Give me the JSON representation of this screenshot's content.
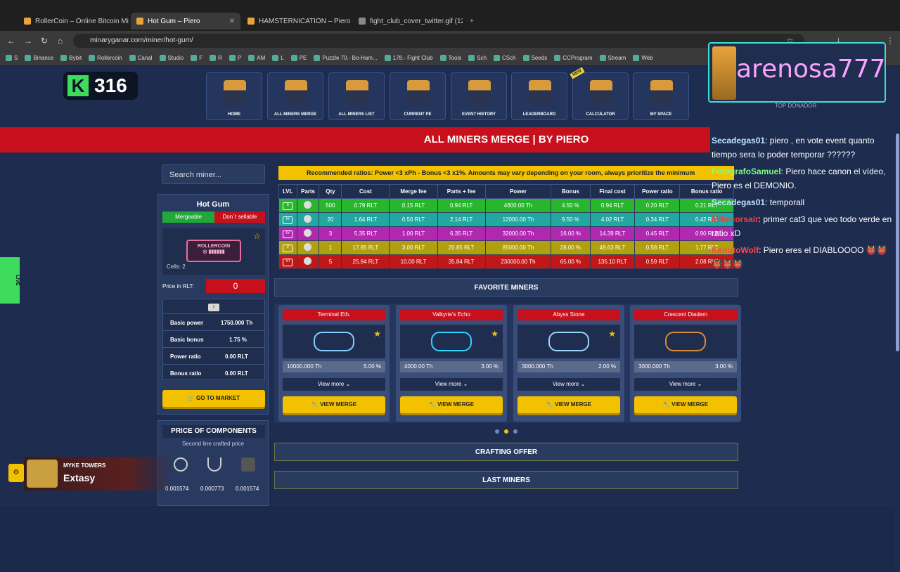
{
  "browser": {
    "tabs": [
      {
        "title": "RollerCoin – Online Bitcoin Mi",
        "active": false
      },
      {
        "title": "Hot Gum – Piero",
        "active": true
      },
      {
        "title": "HAMSTERNICATION – Piero",
        "active": false
      },
      {
        "title": "fight_club_cover_twitter.gif (12",
        "active": false
      }
    ],
    "url": "minaryganar.com/miner/hot-gum/",
    "bookmarks": [
      "S",
      "Binance",
      "Bybit",
      "Rollercoin",
      "Canal",
      "Studio",
      "F",
      "R",
      "P",
      "AM",
      "L",
      "PE",
      "Puzzle 70.- Bo-Ham...",
      "178.- Fight Club",
      "Tools",
      "Sch",
      "CSch",
      "Seeds",
      "CCProgram",
      "Stream",
      "Web"
    ]
  },
  "site": {
    "logo_count": "316",
    "nav": [
      {
        "label": "HOME"
      },
      {
        "label": "ALL MINERS MERGE"
      },
      {
        "label": "ALL MINERS LIST"
      },
      {
        "label": "CURRENT PE"
      },
      {
        "label": "EVENT HISTORY"
      },
      {
        "label": "LEADERBOARD"
      },
      {
        "label": "CALCULATOR",
        "badge": "NEW"
      },
      {
        "label": "MY SPACE"
      }
    ],
    "banner_title": "ALL MINERS MERGE | BY PIERO"
  },
  "left": {
    "search_placeholder": "Search miner...",
    "miner_name": "Hot Gum",
    "mergeable": "Mergeable",
    "not_sellable": "Don´t sellable",
    "miner_image_text": "ROLLERCOIN",
    "cells": "Cells: 2",
    "price_label": "Price in RLT:",
    "price_value": "0",
    "level_badge": "I",
    "stats": [
      {
        "label": "Basic power",
        "value": "1750.000 Th"
      },
      {
        "label": "Basic bonus",
        "value": "1.75 %"
      },
      {
        "label": "Power ratio",
        "value": "0.00 RLT"
      },
      {
        "label": "Bonus ratio",
        "value": "0.00 RLT"
      }
    ],
    "go_market": "GO TO MARKET",
    "price_components_title": "PRICE OF COMPONENTS",
    "price_components_sub": "Second line crafted price",
    "components": [
      "0.001574",
      "0.000773",
      "0.001574"
    ]
  },
  "ratios": {
    "recommendation": "Recommended ratios: Power <3 xPh - Bonus <3 x1%. Amounts may vary depending on your room, always prioritize the minimum",
    "headers": [
      "LVL",
      "Parts",
      "Qty",
      "Cost",
      "Merge fee",
      "Parts + fee",
      "Power",
      "Bonus",
      "Final cost",
      "Power ratio",
      "Bonus ratio"
    ],
    "rows": [
      {
        "lvl": "II",
        "color": "#2ab52e",
        "qty": "500",
        "cost": "0.79 RLT",
        "fee": "0.15 RLT",
        "parts_fee": "0.94 RLT",
        "power": "4600.00 Th",
        "bonus": "4.50 %",
        "final": "0.94 RLT",
        "pratio": "0.20 RLT",
        "bratio": "0.21 RLT"
      },
      {
        "lvl": "III",
        "color": "#22a8a0",
        "qty": "20",
        "cost": "1.64 RLT",
        "fee": "0.50 RLT",
        "parts_fee": "2.14 RLT",
        "power": "12000.00 Th",
        "bonus": "9.50 %",
        "final": "4.02 RLT",
        "pratio": "0.34 RLT",
        "bratio": "0.42 RLT"
      },
      {
        "lvl": "IV",
        "color": "#b028b0",
        "qty": "3",
        "cost": "5.35 RLT",
        "fee": "1.00 RLT",
        "parts_fee": "6.35 RLT",
        "power": "32000.00 Th",
        "bonus": "16.00 %",
        "final": "14.39 RLT",
        "pratio": "0.45 RLT",
        "bratio": "0.90 RLT"
      },
      {
        "lvl": "V",
        "color": "#b0a010",
        "qty": "1",
        "cost": "17.85 RLT",
        "fee": "3.00 RLT",
        "parts_fee": "20.85 RLT",
        "power": "85000.00 Th",
        "bonus": "28.00 %",
        "final": "49.63 RLT",
        "pratio": "0.58 RLT",
        "bratio": "1.77 RLT"
      },
      {
        "lvl": "VI",
        "color": "#c01818",
        "qty": "5",
        "cost": "25.84 RLT",
        "fee": "10.00 RLT",
        "parts_fee": "35.84 RLT",
        "power": "230000.00 Th",
        "bonus": "65.00 %",
        "final": "135.10 RLT",
        "pratio": "0.59 RLT",
        "bratio": "2.08 RLT"
      }
    ]
  },
  "favorites": {
    "title": "FAVORITE MINERS",
    "cards": [
      {
        "name": "Terminal Eth.",
        "power": "10000.000 Th",
        "bonus": "5.00 %"
      },
      {
        "name": "Valkyrie's Echo",
        "power": "4000.00 Th",
        "bonus": "3.00 %"
      },
      {
        "name": "Abyss Stone",
        "power": "3000.000 Th",
        "bonus": "2.00 %"
      },
      {
        "name": "Crescent Diadem",
        "power": "3000.000 Th",
        "bonus": "3.00 %"
      }
    ],
    "view_more": "View more",
    "view_merge": "VIEW MERGE"
  },
  "sections": {
    "crafting": "CRAFTING OFFER",
    "last_miners": "LAST MINERS"
  },
  "stream": {
    "donor_name": "arenosa777",
    "donor_tag": "TOP DONADOR",
    "chat": [
      {
        "user": "Secadegas01",
        "msg": ": piero , en vote event quanto tiempo sera lo poder temporar ??????",
        "color": "#bfe8ff"
      },
      {
        "user": "FotografoSamuel",
        "msg": ": Piero hace canon el vídeo, Piero es el DEMONIO.",
        "color": "#7fff7f"
      },
      {
        "user": "Secadegas01",
        "msg": ": temporall",
        "color": "#bfe8ff"
      },
      {
        "user": "Mikecorsair",
        "msg": ": primer cat3 que veo todo verde en ratio xD",
        "color": "#ff3a3a"
      },
      {
        "user": "KanutoWolf",
        "msg": ": Piero eres el DIABLOOOO 👹👹👹👹👹",
        "color": "#ff4a4a"
      }
    ],
    "live_label": "LIVE",
    "now_playing_artist": "MYKE TOWERS",
    "now_playing_song": "Extasy"
  }
}
